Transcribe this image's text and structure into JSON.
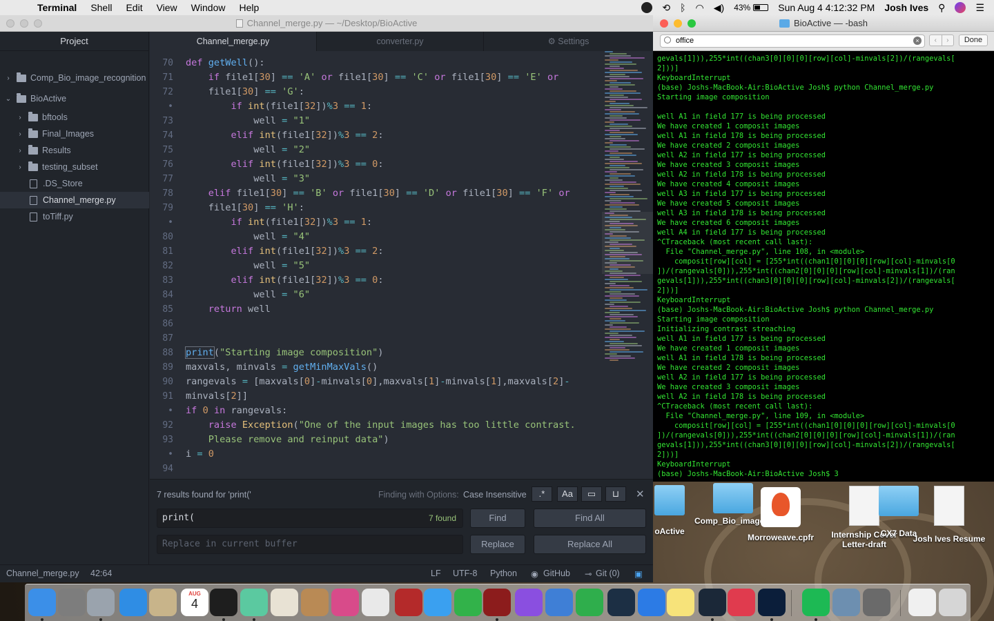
{
  "menubar": {
    "app": "Terminal",
    "items": [
      "Shell",
      "Edit",
      "View",
      "Window",
      "Help"
    ],
    "battery": "43%",
    "datetime": "Sun Aug 4  4:12:32 PM",
    "user": "Josh Ives"
  },
  "atom": {
    "title": "Channel_merge.py — ~/Desktop/BioActive",
    "tree_header": "Project",
    "tree": [
      {
        "label": "Comp_Bio_image_recognition",
        "type": "folder",
        "depth": 0,
        "chev": "›"
      },
      {
        "label": "BioActive",
        "type": "folder",
        "depth": 0,
        "chev": "⌄"
      },
      {
        "label": "bftools",
        "type": "folder",
        "depth": 1,
        "chev": "›"
      },
      {
        "label": "Final_Images",
        "type": "folder",
        "depth": 1,
        "chev": "›"
      },
      {
        "label": "Results",
        "type": "folder",
        "depth": 1,
        "chev": "›"
      },
      {
        "label": "testing_subset",
        "type": "folder",
        "depth": 1,
        "chev": "›"
      },
      {
        "label": ".DS_Store",
        "type": "file",
        "depth": 1,
        "chev": ""
      },
      {
        "label": "Channel_merge.py",
        "type": "file",
        "depth": 1,
        "chev": "",
        "selected": true
      },
      {
        "label": "toTiff.py",
        "type": "file",
        "depth": 1,
        "chev": ""
      }
    ],
    "tabs": [
      "Channel_merge.py",
      "converter.py",
      "Settings"
    ],
    "line_numbers": [
      "70",
      "71",
      "72",
      "•",
      "73",
      "74",
      "75",
      "76",
      "77",
      "78",
      "79",
      "•",
      "80",
      "81",
      "82",
      "83",
      "84",
      "85",
      "86",
      "87",
      "88",
      "89",
      "90",
      "91",
      "•",
      "92",
      "93",
      "•",
      "94"
    ],
    "find": {
      "results": "7 results found for 'print('",
      "options_label": "Finding with Options:",
      "options_value": "Case Insensitive",
      "query": "print(",
      "found": "7 found",
      "replace_placeholder": "Replace in current buffer",
      "find_btn": "Find",
      "find_all_btn": "Find All",
      "replace_btn": "Replace",
      "replace_all_btn": "Replace All"
    },
    "status": {
      "file": "Channel_merge.py",
      "cursor": "42:64",
      "eol": "LF",
      "encoding": "UTF-8",
      "grammar": "Python",
      "github": "GitHub",
      "git": "Git (0)"
    }
  },
  "terminal": {
    "title": "BioActive — -bash",
    "search": "office",
    "done": "Done",
    "lines": [
      "gevals[1])),255*int((chan3[0][0][0][row][col]-minvals[2])/(rangevals[",
      "2]))]",
      "KeyboardInterrupt",
      "(base) Joshs-MacBook-Air:BioActive Josh$ python Channel_merge.py",
      "Starting image composition",
      "",
      "well A1 in field 177 is being processed",
      "We have created 1 composit images",
      "well A1 in field 178 is being processed",
      "We have created 2 composit images",
      "well A2 in field 177 is being processed",
      "We have created 3 composit images",
      "well A2 in field 178 is being processed",
      "We have created 4 composit images",
      "well A3 in field 177 is being processed",
      "We have created 5 composit images",
      "well A3 in field 178 is being processed",
      "We have created 6 composit images",
      "well A4 in field 177 is being processed",
      "^CTraceback (most recent call last):",
      "  File \"Channel_merge.py\", line 108, in <module>",
      "    composit[row][col] = [255*int((chan1[0][0][0][row][col]-minvals[0",
      "])/(rangevals[0])),255*int((chan2[0][0][0][row][col]-minvals[1])/(ran",
      "gevals[1])),255*int((chan3[0][0][0][row][col]-minvals[2])/(rangevals[",
      "2]))]",
      "KeyboardInterrupt",
      "(base) Joshs-MacBook-Air:BioActive Josh$ python Channel_merge.py",
      "Starting image composition",
      "Initializing contrast streaching",
      "well A1 in field 177 is being processed",
      "We have created 1 composit images",
      "well A1 in field 178 is being processed",
      "We have created 2 composit images",
      "well A2 in field 177 is being processed",
      "We have created 3 composit images",
      "well A2 in field 178 is being processed",
      "^CTraceback (most recent call last):",
      "  File \"Channel_merge.py\", line 109, in <module>",
      "    composit[row][col] = [255*int((chan1[0][0][0][row][col]-minvals[0",
      "])/(rangevals[0])),255*int((chan2[0][0][0][row][col]-minvals[1])/(ran",
      "gevals[1])),255*int((chan3[0][0][0][row][col]-minvals[2])/(rangevals[",
      "2]))]",
      "KeyboardInterrupt",
      "(base) Joshs-MacBook-Air:BioActive Josh$ 3"
    ]
  },
  "desktop": {
    "icons": [
      {
        "label": "oActive",
        "kind": "folder"
      },
      {
        "label": "Comp_Bio_image_recognition",
        "kind": "folder"
      },
      {
        "label": "Morroweave.cpfr",
        "kind": "app"
      },
      {
        "label": "Internship Cover Letter-draft",
        "kind": "doc"
      },
      {
        "label": "CX7 Data",
        "kind": "folder"
      },
      {
        "label": "Josh Ives Resume",
        "kind": "doc"
      }
    ]
  },
  "dock": {
    "apps": [
      "finder-icon",
      "system-preferences-icon",
      "launchpad-icon",
      "safari-icon",
      "preview-icon",
      "calendar-icon",
      "terminal-icon",
      "atom-icon",
      "textedit-icon",
      "notes-book-icon",
      "colorsync-icon",
      "photos-icon",
      "dictionary-icon",
      "messages-icon",
      "facetime-icon",
      "photo-booth-icon",
      "imovie-icon",
      "keynote-icon",
      "numbers-icon",
      "quicktime-icon",
      "app-store-icon",
      "notes-icon",
      "steam-icon",
      "news-icon",
      "photoshop-icon",
      "spotify-icon",
      "finder-gallery-icon",
      "instruments-icon",
      "documents-icon",
      "trash-icon"
    ],
    "calendar_month": "AUG",
    "calendar_day": "4"
  }
}
